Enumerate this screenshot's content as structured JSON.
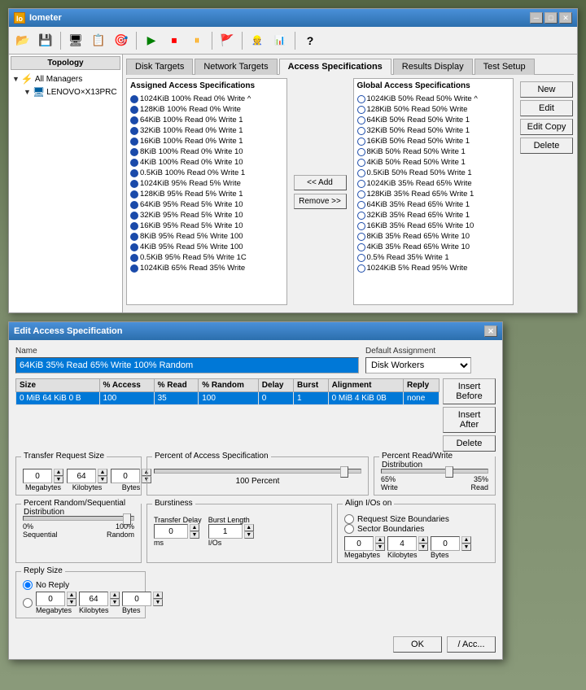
{
  "main_window": {
    "title": "Iometer",
    "title_icon": "Io",
    "toolbar_buttons": [
      {
        "name": "open",
        "icon": "📂"
      },
      {
        "name": "save",
        "icon": "💾"
      },
      {
        "name": "display",
        "icon": "🖥"
      },
      {
        "name": "config",
        "icon": "📋"
      },
      {
        "name": "targets",
        "icon": "🎯"
      },
      {
        "name": "start",
        "icon": "▶"
      },
      {
        "name": "stop_all",
        "icon": "⏹"
      },
      {
        "name": "stop",
        "icon": "⏸"
      },
      {
        "name": "reset",
        "icon": "↩"
      },
      {
        "name": "workers",
        "icon": "👷"
      },
      {
        "name": "managers",
        "icon": "📊"
      },
      {
        "name": "help",
        "icon": "?"
      }
    ]
  },
  "topology": {
    "header": "Topology",
    "items": [
      {
        "label": "All Managers",
        "level": 0,
        "type": "root"
      },
      {
        "label": "LENOVO×X13PRC",
        "level": 1,
        "type": "pc"
      }
    ]
  },
  "tabs": {
    "items": [
      {
        "label": "Disk Targets",
        "active": false
      },
      {
        "label": "Network Targets",
        "active": false
      },
      {
        "label": "Access Specifications",
        "active": true
      },
      {
        "label": "Results Display",
        "active": false
      },
      {
        "label": "Test Setup",
        "active": false
      }
    ]
  },
  "assigned_specs": {
    "header": "Assigned Access Specifications",
    "items": [
      "1024KiB 100% Read 0% Write",
      "128KiB 100% Read 0% Write",
      "64KiB 100% Read 0% Write 1",
      "32KiB 100% Read 0% Write 1",
      "16KiB 100% Read 0% Write 1",
      "8KiB 100% Read 0% Write 10",
      "4KiB 100% Read 0% Write 10",
      "0.5KiB 100% Read 0% Write 1",
      "1024KiB 95% Read 5% Write",
      "128KiB 95% Read 5% Write 1",
      "64KiB 95% Read 5% Write 10",
      "32KiB 95% Read 5% Write 10",
      "16KiB 95% Read 5% Write 10",
      "8KiB 95% Read 5% Write 100",
      "4KiB 95% Read 5% Write 100",
      "0.5KiB 95% Read 5% Write 1C",
      "1024KiB 65% Read 35% Write"
    ]
  },
  "global_specs": {
    "header": "Global Access Specifications",
    "items": [
      "1024KiB 50% Read 50% Write",
      "128KiB 50% Read 50% Write",
      "64KiB 50% Read 50% Write 1",
      "32KiB 50% Read 50% Write 1",
      "16KiB 50% Read 50% Write 1",
      "8KiB 50% Read 50% Write 1",
      "4KiB 50% Read 50% Write 1",
      "0.5KiB 50% Read 50% Write 1",
      "1024KiB 35% Read 65% Write",
      "128KiB 35% Read 65% Write 1",
      "64KiB 35% Read 65% Write 1",
      "32KiB 35% Read 65% Write 1",
      "16KiB 35% Read 65% Write 10",
      "8KiB 35% Read 65% Write 10",
      "4KiB 35% Read 65% Write 10",
      "0.5% Read 35% Write 1",
      "1024KiB 5% Read 95% Write"
    ]
  },
  "middle_buttons": {
    "add": "<< Add",
    "remove": "Remove >>"
  },
  "action_buttons": {
    "new": "New",
    "edit": "Edit",
    "edit_copy": "Edit Copy",
    "delete": "Delete"
  },
  "dialog": {
    "title": "Edit Access Specification",
    "name_label": "Name",
    "name_value": "64KiB 35% Read 65% Write 100% Random",
    "default_assignment_label": "Default Assignment",
    "default_assignment_value": "Disk Workers",
    "table_headers": [
      "Size",
      "% Access",
      "% Read",
      "% Random",
      "Delay",
      "Burst",
      "Alignment",
      "Reply"
    ],
    "table_row": {
      "size": "0 MiB  64 KiB  0 B",
      "access": "100",
      "read": "35",
      "random": "100",
      "delay": "0",
      "burst": "1",
      "alignment": "0 MiB  4 KiB  0B",
      "reply": "none"
    },
    "insert_before": "Insert Before",
    "insert_after": "Insert After",
    "delete": "Delete",
    "transfer_request_size": {
      "label": "Transfer Request Size",
      "megabytes_label": "Megabytes",
      "kilobytes_label": "Kilobytes",
      "bytes_label": "Bytes",
      "megabytes_value": "0",
      "kilobytes_value": "64",
      "bytes_value": "0"
    },
    "percent_access": {
      "label": "Percent of Access Specification",
      "value": "100 Percent"
    },
    "percent_rw": {
      "label": "Percent Read/Write Distribution",
      "write_label": "Write",
      "read_label": "Read",
      "write_value": "65%",
      "read_value": "35%"
    },
    "percent_random": {
      "label": "Percent Random/Sequential Distribution",
      "sequential_label": "Sequential",
      "random_label": "Random",
      "sequential_value": "0%",
      "random_value": "100%"
    },
    "burstiness": {
      "label": "Burstiness",
      "transfer_delay_label": "Transfer Delay",
      "burst_length_label": "Burst Length",
      "ms_label": "ms",
      "ios_label": "I/Os",
      "delay_value": "0",
      "burst_value": "1"
    },
    "align_ios": {
      "label": "Align I/Os on",
      "options": [
        "Request Size Boundaries",
        "Sector Boundaries"
      ],
      "megabytes_label": "Megabytes",
      "kilobytes_label": "Kilobytes",
      "bytes_label": "Bytes",
      "megabytes_value": "0",
      "kilobytes_value": "4",
      "bytes_value": "0"
    },
    "reply_size": {
      "label": "Reply Size",
      "no_reply": "No Reply",
      "megabytes_label": "Megabytes",
      "kilobytes_label": "Kilobytes",
      "bytes_label": "Bytes",
      "megabytes_value": "0",
      "kilobytes_value": "64",
      "bytes_value": "0"
    },
    "ok_label": "OK",
    "cancel_label": "/ Acc..."
  }
}
